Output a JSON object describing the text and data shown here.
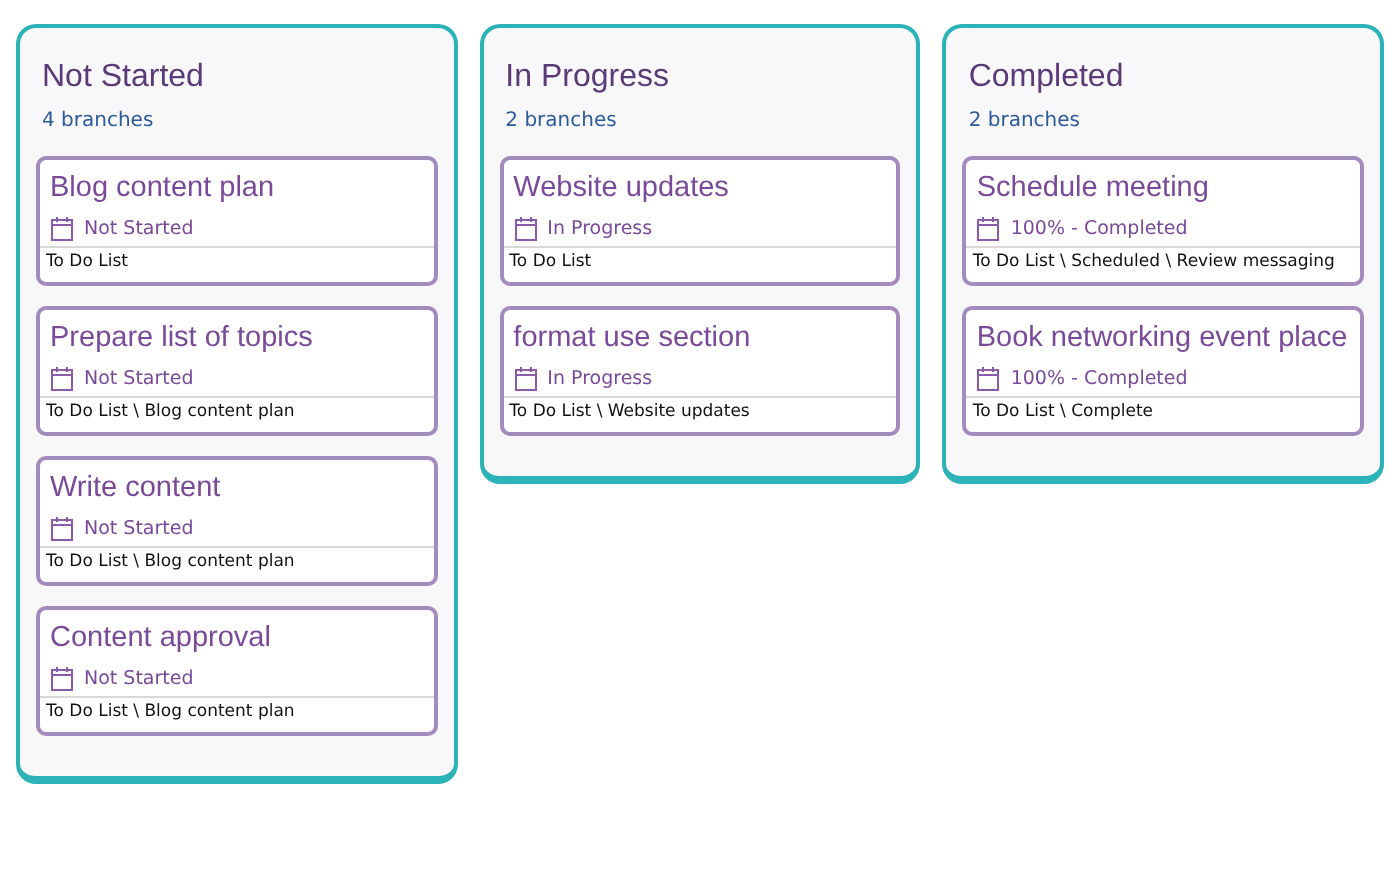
{
  "columns": [
    {
      "title": "Not Started",
      "count": "4 branches",
      "cards": [
        {
          "title": "Blog content plan",
          "status": "Not Started",
          "path": "To Do List"
        },
        {
          "title": "Prepare list of topics",
          "status": "Not Started",
          "path": "To Do List \\ Blog content plan"
        },
        {
          "title": "Write content",
          "status": "Not Started",
          "path": "To Do List \\ Blog content plan"
        },
        {
          "title": "Content approval",
          "status": "Not Started",
          "path": "To Do List \\ Blog content plan"
        }
      ]
    },
    {
      "title": "In Progress",
      "count": "2 branches",
      "cards": [
        {
          "title": "Website updates",
          "status": "In Progress",
          "path": "To Do List"
        },
        {
          "title": "format use section",
          "status": "In Progress",
          "path": "To Do List \\ Website updates"
        }
      ]
    },
    {
      "title": "Completed",
      "count": "2 branches",
      "cards": [
        {
          "title": "Schedule meeting",
          "status": "100% - Completed",
          "path": "To Do List \\ Scheduled \\ Review messaging"
        },
        {
          "title": "Book networking event place",
          "status": "100% - Completed",
          "path": "To Do List \\ Complete"
        }
      ]
    }
  ]
}
